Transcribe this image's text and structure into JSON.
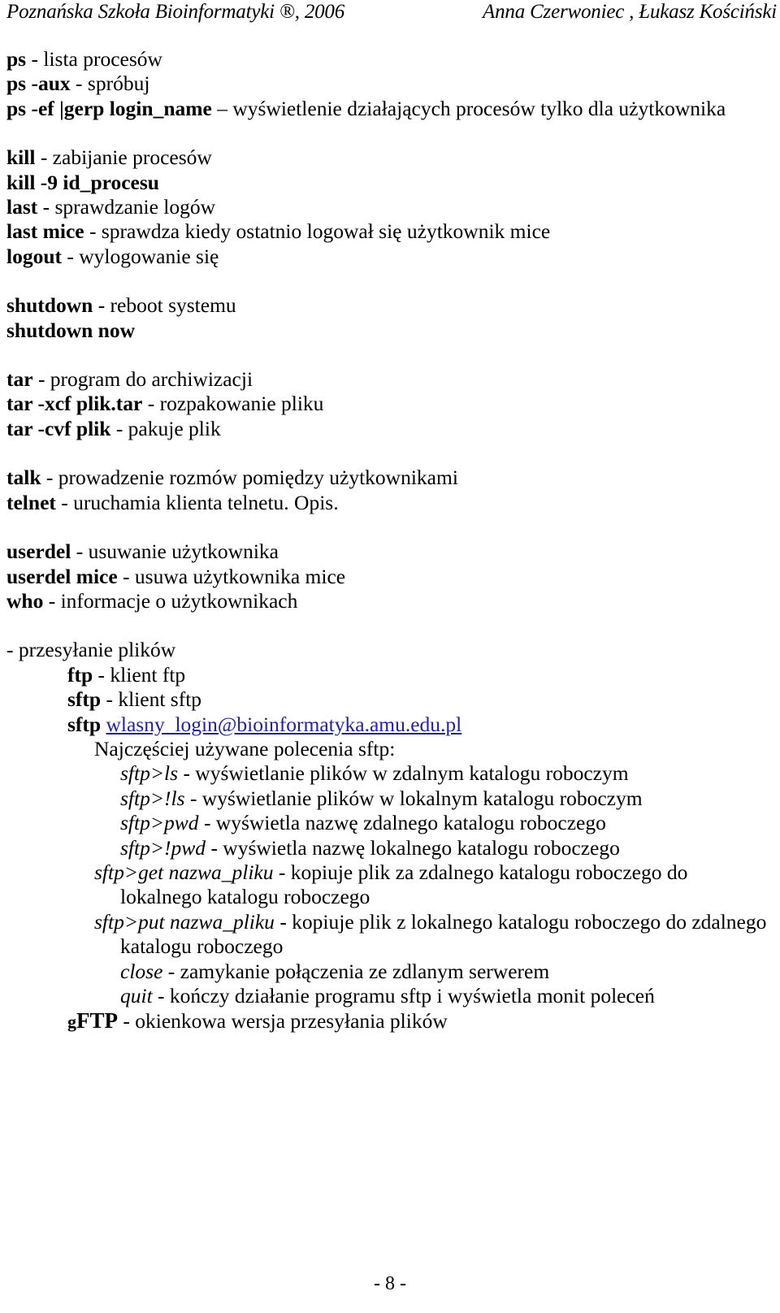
{
  "header": {
    "left": "Poznańska Szkoła Bioinformatyki ®, 2006",
    "right": "Anna Czerwoniec , Łukasz Kościński"
  },
  "footer": {
    "page_number": "- 8 -"
  },
  "content": {
    "ps_list": {
      "cmd": "ps",
      "desc": " - lista procesów"
    },
    "ps_aux": {
      "cmd": "ps -aux",
      "desc": " - spróbuj"
    },
    "ps_ef": {
      "cmd": "ps -ef |gerp login_name",
      "desc": " – wyświetlenie działających procesów tylko dla użytkownika"
    },
    "kill": {
      "cmd": "kill",
      "desc": " - zabijanie procesów"
    },
    "kill9": {
      "cmd": "kill -9 id_procesu",
      "desc": ""
    },
    "last": {
      "cmd": "last",
      "desc": " - sprawdzanie logów"
    },
    "last_mice": {
      "cmd": "last mice",
      "desc": " - sprawdza kiedy ostatnio logował się użytkownik mice"
    },
    "logout": {
      "cmd": "logout",
      "desc": " - wylogowanie się"
    },
    "shutdown": {
      "cmd": "shutdown",
      "desc": " - reboot systemu"
    },
    "shutdown_now": {
      "cmd": "shutdown now",
      "desc": ""
    },
    "tar": {
      "cmd": "tar",
      "desc": " - program do archiwizacji"
    },
    "tar_xcf": {
      "cmd": "tar -xcf plik.tar",
      "desc": " - rozpakowanie pliku"
    },
    "tar_cvf": {
      "cmd": "tar -cvf plik",
      "desc": " - pakuje plik"
    },
    "talk": {
      "cmd": "talk",
      "desc": " - prowadzenie rozmów pomiędzy użytkownikami"
    },
    "telnet": {
      "cmd": "telnet",
      "desc": " - uruchamia klienta telnetu. Opis."
    },
    "userdel": {
      "cmd": "userdel",
      "desc": " - usuwanie użytkownika"
    },
    "userdel_mice": {
      "cmd": "userdel mice",
      "desc": " - usuwa użytkownika mice"
    },
    "who": {
      "cmd": "who",
      "desc": " - informacje o użytkownikach"
    },
    "transfer_heading": "- przesyłanie plików",
    "ftp": {
      "cmd": "ftp",
      "desc": " - klient ftp"
    },
    "sftp": {
      "cmd": "sftp",
      "desc": " - klient sftp"
    },
    "sftp_login": {
      "cmd": "sftp",
      "link": "wlasny_login@bioinformatyka.amu.edu.pl"
    },
    "sftp_intro": "Najczęściej używane polecenia sftp:",
    "sftp_commands": [
      {
        "cmd": "sftp>ls",
        "desc": " -  wyświetlanie plików w zdalnym katalogu roboczym"
      },
      {
        "cmd": "sftp>!ls",
        "desc": " - wyświetlanie plików w lokalnym katalogu roboczym"
      },
      {
        "cmd": "sftp>pwd",
        "desc": " - wyświetla nazwę zdalnego katalogu roboczego"
      },
      {
        "cmd": "sftp>!pwd",
        "desc": " - wyświetla nazwę lokalnego katalogu roboczego"
      },
      {
        "cmd": "sftp>get nazwa_pliku",
        "desc": " - kopiuje plik za zdalnego katalogu roboczego do lokalnego katalogu roboczego"
      },
      {
        "cmd": "sftp>put nazwa_pliku",
        "desc": " - kopiuje plik z lokalnego katalogu  roboczego do zdalnego katalogu roboczego"
      },
      {
        "cmd": "close",
        "desc": " - zamykanie połączenia ze zdlanym serwerem"
      },
      {
        "cmd": "quit",
        "desc": " - kończy działanie programu sftp i wyświetla monit poleceń"
      }
    ],
    "gftp": {
      "prefix": "g",
      "main": "FTP",
      "desc": " - okienkowa wersja przesyłania plików"
    }
  }
}
